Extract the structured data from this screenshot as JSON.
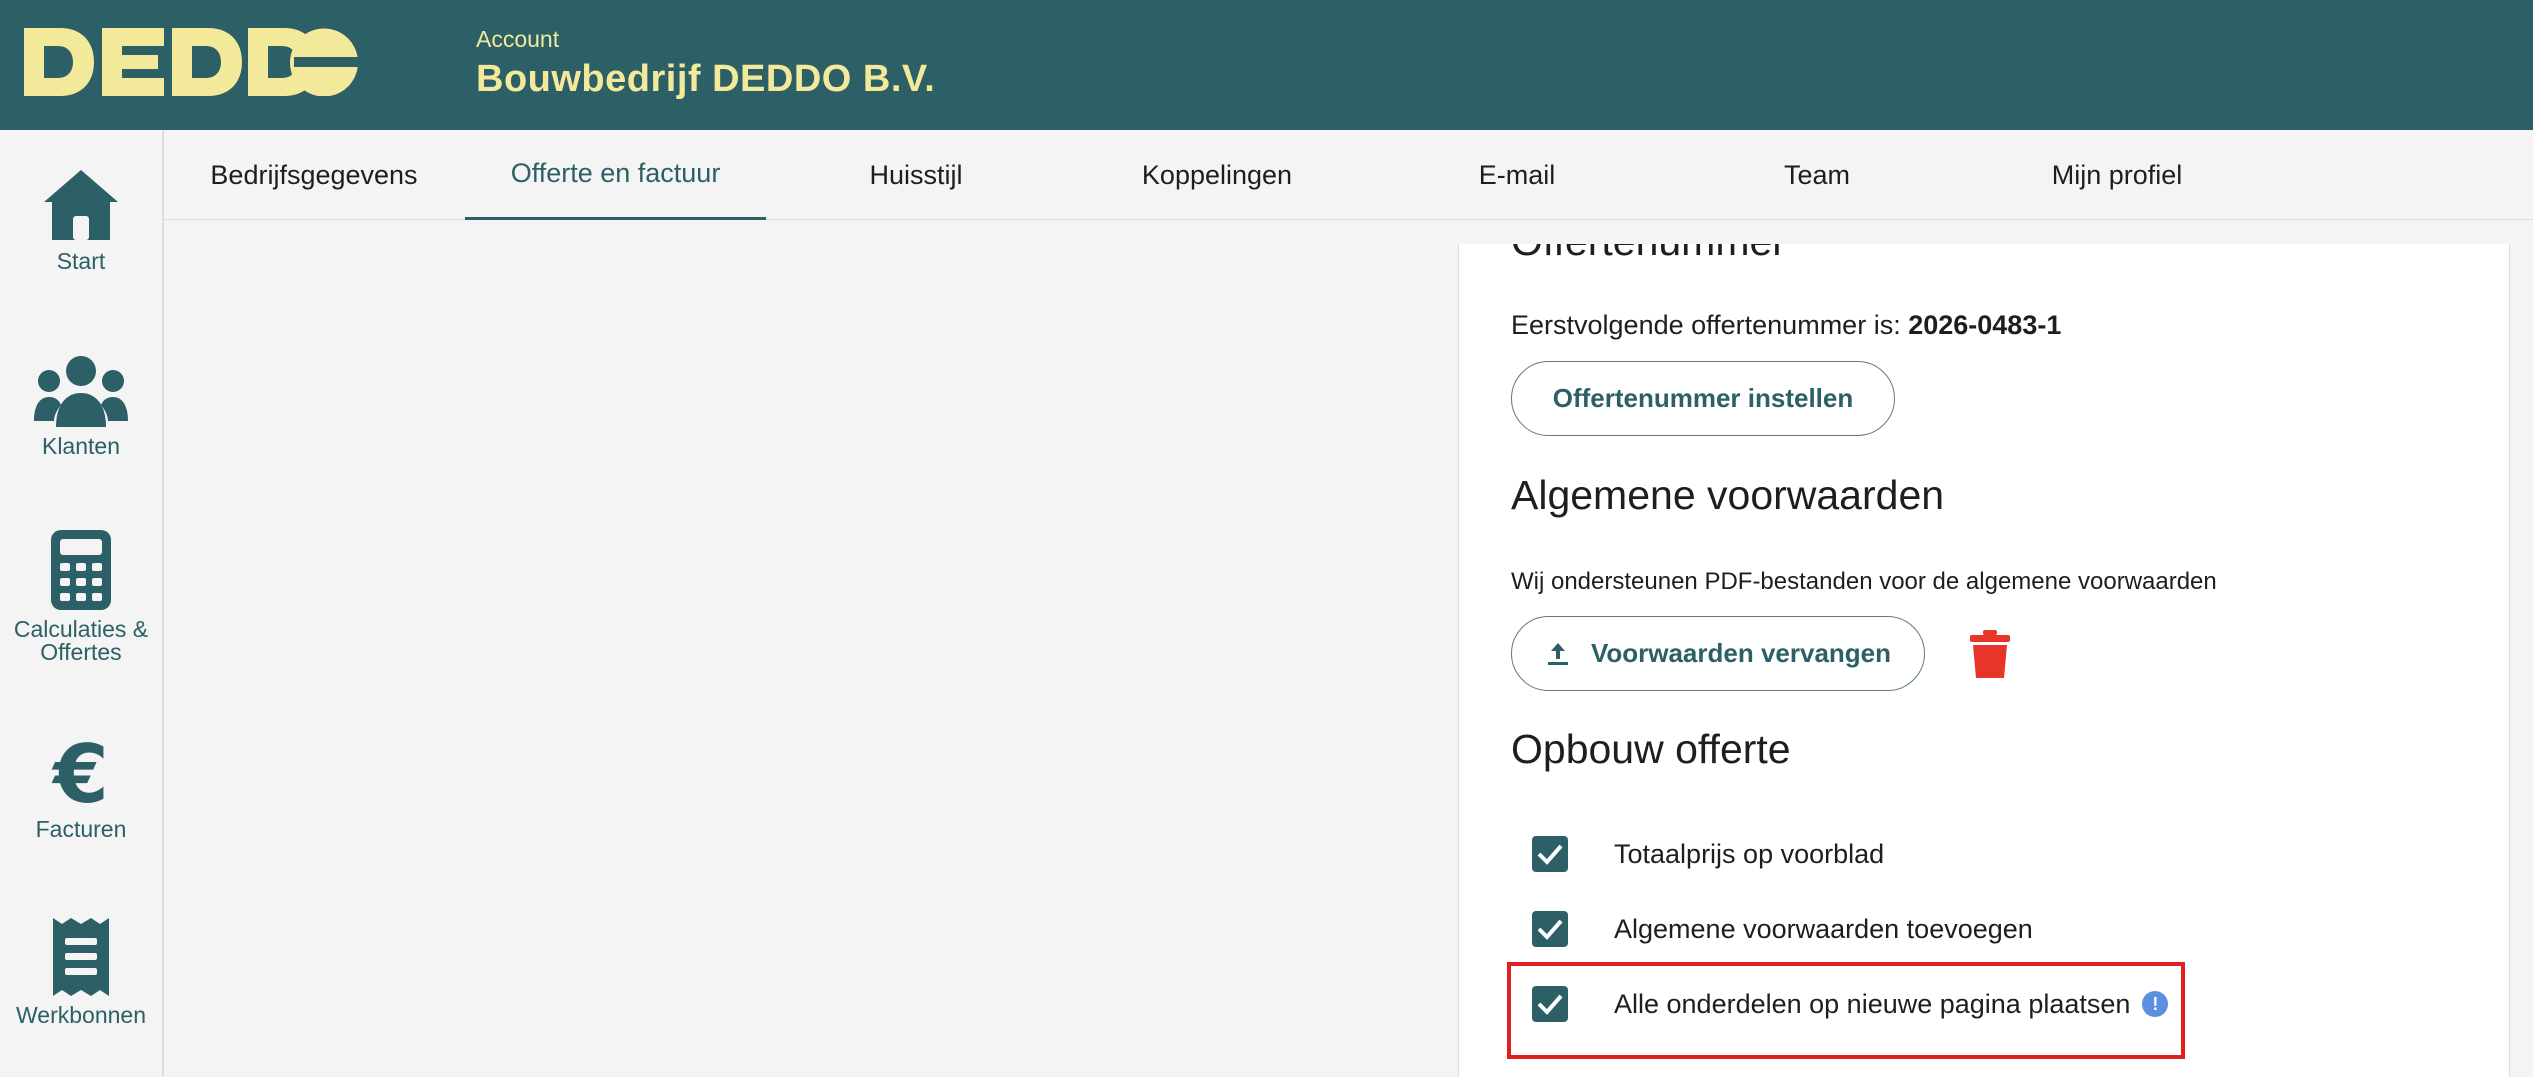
{
  "header": {
    "logo_text": "DEDDO",
    "account_label": "Account",
    "account_name": "Bouwbedrijf DEDDO B.V."
  },
  "sidebar": {
    "items": [
      {
        "label": "Start",
        "icon": "home-icon"
      },
      {
        "label": "Klanten",
        "icon": "users-icon"
      },
      {
        "label": "Calculaties & Offertes",
        "icon": "calculator-icon"
      },
      {
        "label": "Facturen",
        "icon": "euro-icon"
      },
      {
        "label": "Werkbonnen",
        "icon": "receipt-icon"
      }
    ]
  },
  "tabs": [
    {
      "label": "Bedrijfsgegevens",
      "active": false
    },
    {
      "label": "Offerte en factuur",
      "active": true
    },
    {
      "label": "Huisstijl",
      "active": false
    },
    {
      "label": "Koppelingen",
      "active": false
    },
    {
      "label": "E-mail",
      "active": false
    },
    {
      "label": "Team",
      "active": false
    },
    {
      "label": "Mijn profiel",
      "active": false
    }
  ],
  "offertenummer": {
    "heading": "Offertenummer",
    "next_label": "Eerstvolgende offertenummer is:",
    "next_value": "2026-0483-1",
    "set_button": "Offertenummer instellen"
  },
  "voorwaarden": {
    "heading": "Algemene voorwaarden",
    "description": "Wij ondersteunen PDF-bestanden voor de algemene voorwaarden",
    "replace_button": "Voorwaarden vervangen"
  },
  "opbouw": {
    "heading": "Opbouw offerte",
    "options": [
      {
        "label": "Totaalprijs op voorblad",
        "checked": true
      },
      {
        "label": "Algemene voorwaarden toevoegen",
        "checked": true
      },
      {
        "label": "Alle onderdelen op nieuwe pagina plaatsen",
        "checked": true
      }
    ],
    "info_glyph": "!"
  },
  "colors": {
    "brand": "#2d5f66",
    "logo_yellow": "#f3e99a",
    "delete_red": "#e8352a",
    "highlight_red": "#e02020",
    "info_blue": "#5b8fe0"
  }
}
